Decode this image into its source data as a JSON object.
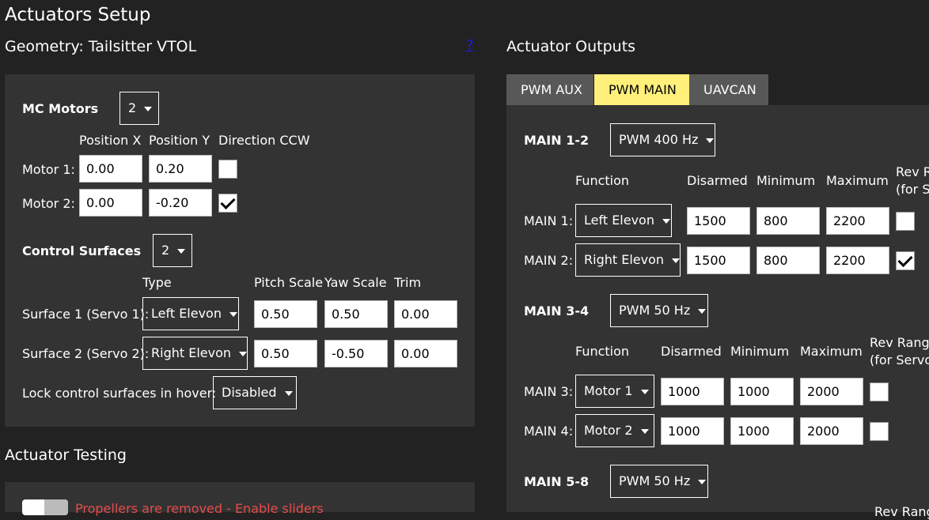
{
  "page_title": "Actuators Setup",
  "geometry": {
    "heading": "Geometry: Tailsitter VTOL",
    "help_link": "?",
    "mc_motors": {
      "label": "MC Motors",
      "count": "2",
      "columns": [
        "Position X",
        "Position Y",
        "Direction CCW"
      ],
      "rows": [
        {
          "label": "Motor 1:",
          "x": "0.00",
          "y": "0.20",
          "ccw": false
        },
        {
          "label": "Motor 2:",
          "x": "0.00",
          "y": "-0.20",
          "ccw": true
        }
      ]
    },
    "control_surfaces": {
      "label": "Control Surfaces",
      "count": "2",
      "columns": [
        "Type",
        "Pitch Scale",
        "Yaw Scale",
        "Trim"
      ],
      "rows": [
        {
          "label": "Surface 1 (Servo 1):",
          "type": "Left Elevon",
          "pitch": "0.50",
          "yaw": "0.50",
          "trim": "0.00"
        },
        {
          "label": "Surface 2 (Servo 2):",
          "type": "Right Elevon",
          "pitch": "0.50",
          "yaw": "-0.50",
          "trim": "0.00"
        }
      ]
    },
    "lock_hover": {
      "label": "Lock control surfaces in hover:",
      "value": "Disabled"
    }
  },
  "testing": {
    "heading": "Actuator Testing",
    "enable_sliders_text": "Propellers are removed - Enable sliders"
  },
  "outputs": {
    "heading": "Actuator Outputs",
    "tabs": [
      {
        "label": "PWM AUX",
        "active": false
      },
      {
        "label": "PWM MAIN",
        "active": true
      },
      {
        "label": "UAVCAN",
        "active": false
      }
    ],
    "groups": [
      {
        "label": "MAIN 1-2",
        "rate": "PWM 400 Hz",
        "columns": [
          "Function",
          "Disarmed",
          "Minimum",
          "Maximum",
          "Rev Range",
          "(for Se"
        ],
        "rows": [
          {
            "label": "MAIN 1:",
            "function": "Left Elevon",
            "disarmed": "1500",
            "min": "800",
            "max": "2200",
            "rev": false
          },
          {
            "label": "MAIN 2:",
            "function": "Right Elevon",
            "disarmed": "1500",
            "min": "800",
            "max": "2200",
            "rev": true
          }
        ]
      },
      {
        "label": "MAIN 3-4",
        "rate": "PWM 50 Hz",
        "columns": [
          "Function",
          "Disarmed",
          "Minimum",
          "Maximum",
          "Rev Range",
          "(for Servo"
        ],
        "rows": [
          {
            "label": "MAIN 3:",
            "function": "Motor 1",
            "disarmed": "1000",
            "min": "1000",
            "max": "2000",
            "rev": false
          },
          {
            "label": "MAIN 4:",
            "function": "Motor 2",
            "disarmed": "1000",
            "min": "1000",
            "max": "2000",
            "rev": false
          }
        ]
      },
      {
        "label": "MAIN 5-8",
        "rate": "PWM 50 Hz",
        "columns": [
          "Rev Range"
        ]
      }
    ]
  },
  "colors": {
    "background": "#222222",
    "panel": "#333333",
    "active_tab": "#ffef7b",
    "inactive_tab": "#585858",
    "warning_text": "#e84a4a",
    "help_link": "#1a1aff"
  }
}
